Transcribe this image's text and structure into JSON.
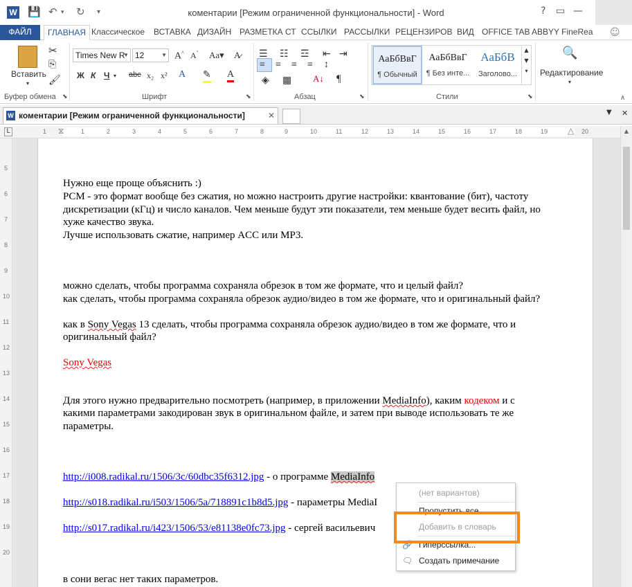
{
  "window": {
    "title": "коментарии [Режим ограниченной функциональности] - Word",
    "help": "?",
    "minimize": "—",
    "restore": "❐",
    "close": "✕"
  },
  "ribbon_tabs": [
    "ФАЙЛ",
    "ГЛАВНАЯ",
    "Классическое",
    "ВСТАВКА",
    "ДИЗАЙН",
    "РАЗМЕТКА СТ",
    "ССЫЛКИ",
    "РАССЫЛКИ",
    "РЕЦЕНЗИРОВ",
    "ВИД",
    "OFFICE TAB",
    "ABBYY FineRea"
  ],
  "ribbon": {
    "clipboard": {
      "paste": "Вставить",
      "label": "Буфер обмена"
    },
    "font": {
      "name": "Times New R",
      "size": "12",
      "label": "Шрифт",
      "bold": "Ж",
      "italic": "К",
      "underline": "Ч",
      "strike": "abc",
      "sub": "x₂",
      "sup": "x²"
    },
    "paragraph": {
      "label": "Абзац"
    },
    "styles": {
      "label": "Стили",
      "items": [
        {
          "sample": "АаБбВвГ",
          "name": "¶ Обычный"
        },
        {
          "sample": "АаБбВвГ",
          "name": "¶ Без инте..."
        },
        {
          "sample": "АаБбВ",
          "name": "Заголово..."
        }
      ]
    },
    "editing": {
      "label": "Редактирование"
    }
  },
  "doc_tab": {
    "title": "коментарии [Режим ограниченной функциональности]",
    "close": "✕"
  },
  "ruler": {
    "h": [
      "1",
      "2",
      "1",
      "2",
      "3",
      "4",
      "5",
      "6",
      "7",
      "8",
      "9",
      "10",
      "11",
      "12",
      "13",
      "14",
      "15",
      "16",
      "17",
      "18",
      "19",
      "20"
    ],
    "v": [
      "5",
      "6",
      "7",
      "8",
      "9",
      "10",
      "11",
      "12",
      "13",
      "14",
      "15",
      "16",
      "17",
      "18",
      "19",
      "20"
    ]
  },
  "document": {
    "p1": "Нужно еще проще объяснить :)",
    "p2a": "PCM - это формат вообще без сжатия, но можно настроить другие настройки: квантование (бит), частоту",
    "p2b": "дискретизации (кГц) и число каналов. Чем меньше будут эти показатели, тем меньше будет весить файл, но",
    "p2c": "хуже качество звука.",
    "p3": "Лучше использовать сжатие, например ACC или MP3.",
    "q1": "можно сделать, чтобы программа сохраняла обрезок в том же формате, что и целый файл?",
    "q2": "как сделать, чтобы программа сохраняла обрезок аудио/видео в том же формате, что и оригинальный файл?",
    "q3a_pre": "как в ",
    "q3a_link": "Sony Vegas",
    "q3a_post": " 13 сделать, чтобы программа сохраняла обрезок аудио/видео в том же формате, что и",
    "q3b": "оригинальный файл?",
    "sony": "Sony Vegas",
    "a1_pre": "Для этого нужно предварительно посмотреть (например, в приложении ",
    "a1_mi": "MediaInfo",
    "a1_mid": "), каким ",
    "a1_codec": "кодеком",
    "a1_post": " и с",
    "a2": "какими параметрами закодирован звук в оригинальном файле, и затем при выводе использовать те же",
    "a3": "параметры.",
    "l1_url": "http://i008.radikal.ru/1506/3c/60dbc35f6312.jpg",
    "l1_text": " - о программе ",
    "l1_mi": "MediaInfo",
    "l2_url": "http://s018.radikal.ru/i503/1506/5a/718891c1b8d5.jpg",
    "l2_text": " - параметры MediaI",
    "l3_url": "http://s017.radikal.ru/i423/1506/53/e81138e0fc73.jpg",
    "l3_text": " - сергей васильевич",
    "last": "в сони вегас нет таких параметров."
  },
  "context_menu": {
    "no_variants": "(нет вариантов)",
    "skip_all": "Пропустить все",
    "add_dict": "Добавить в словарь",
    "hyperlink": "Гиперссылка...",
    "add_comment": "Создать примечание"
  },
  "colors": {
    "accent": "#2b579a",
    "highlight_box": "#f08a24",
    "link": "#0000ee",
    "spell_red": "#e00000"
  }
}
